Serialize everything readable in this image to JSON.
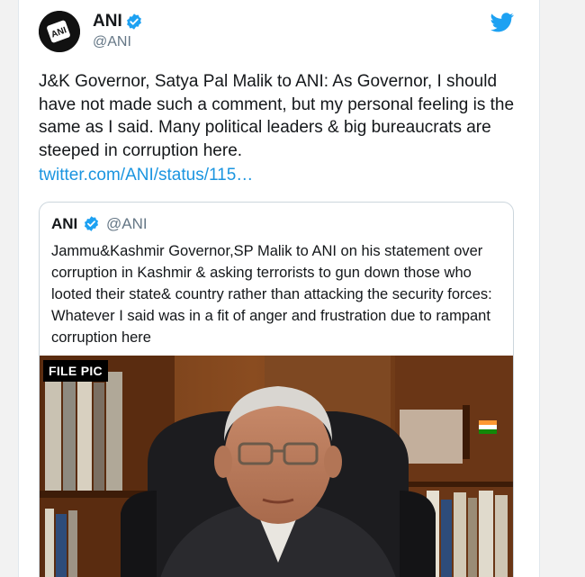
{
  "tweet": {
    "author_name": "ANI",
    "author_handle": "@ANI",
    "text": "J&K Governor, Satya Pal Malik to ANI: As Governor, I should have not made such a comment, but my personal feeling is the same as I said. Many political leaders & big bureaucrats are steeped in corruption here.",
    "link_text": "twitter.com/ANI/status/115…",
    "avatar_icon": "ani-logo-icon",
    "verified_icon": "verified-badge-icon",
    "brand_icon": "twitter-bird-icon"
  },
  "quoted": {
    "author_name": "ANI",
    "author_handle": "@ANI",
    "text": "Jammu&Kashmir Governor,SP Malik to ANI on his statement over corruption in Kashmir & asking terrorists to gun down those who looted their state& country rather than attacking the security forces: Whatever I said was in a fit of anger and frustration due to rampant corruption here",
    "media_label": "FILE PIC"
  },
  "colors": {
    "link": "#1b95e0",
    "verified": "#1da1f2",
    "text": "#14171a",
    "secondary": "#657786"
  }
}
